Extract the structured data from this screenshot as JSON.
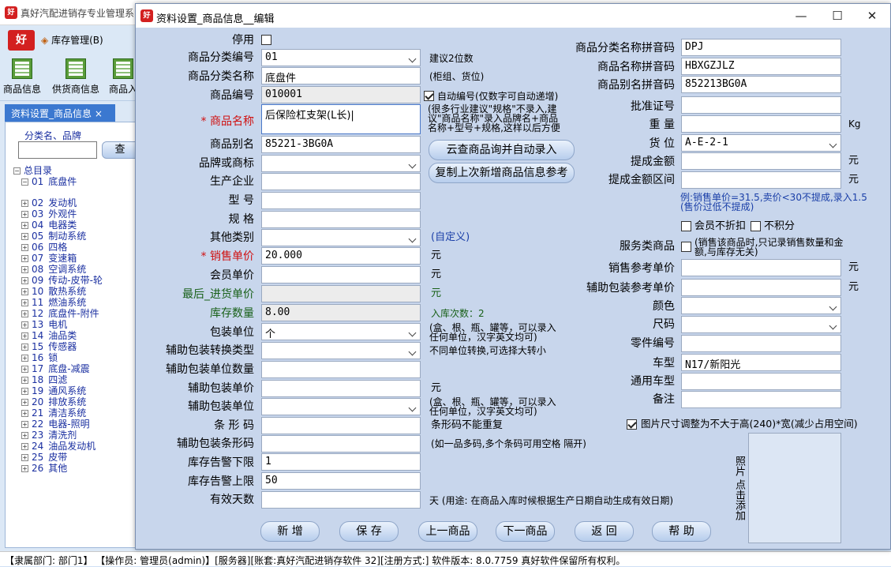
{
  "app": {
    "title": "真好汽配进销存专业管理系",
    "icon_text": "好",
    "menu_inventory": "库存管理(B)"
  },
  "toolbar": [
    {
      "label": "商品信息"
    },
    {
      "label": "供货商信息"
    },
    {
      "label": "商品入"
    }
  ],
  "left_panel": {
    "tab": "资料设置_商品信息",
    "tab_close": "×",
    "search_label": "分类名、品牌",
    "search_value": "",
    "search_button": "查"
  },
  "tree": {
    "root": "总目录",
    "items": [
      {
        "code": "01",
        "name": "底盘件",
        "expanded": true
      },
      {
        "code": "02",
        "name": "发动机"
      },
      {
        "code": "03",
        "name": "外观件"
      },
      {
        "code": "04",
        "name": "电器类"
      },
      {
        "code": "05",
        "name": "制动系统"
      },
      {
        "code": "06",
        "name": "四格"
      },
      {
        "code": "07",
        "name": "变速箱"
      },
      {
        "code": "08",
        "name": "空调系统"
      },
      {
        "code": "09",
        "name": "传动-皮带-轮"
      },
      {
        "code": "10",
        "name": "散热系统"
      },
      {
        "code": "11",
        "name": "燃油系统"
      },
      {
        "code": "12",
        "name": "底盘件-附件"
      },
      {
        "code": "13",
        "name": "电机"
      },
      {
        "code": "14",
        "name": "油品类"
      },
      {
        "code": "15",
        "name": "传感器"
      },
      {
        "code": "16",
        "name": "锁"
      },
      {
        "code": "17",
        "name": "底盘-减震"
      },
      {
        "code": "18",
        "name": "四滤"
      },
      {
        "code": "19",
        "name": "通风系统"
      },
      {
        "code": "20",
        "name": "排放系统"
      },
      {
        "code": "21",
        "name": "清洁系统"
      },
      {
        "code": "22",
        "name": "电器-照明"
      },
      {
        "code": "23",
        "name": "清洗剂"
      },
      {
        "code": "24",
        "name": "油品发动机"
      },
      {
        "code": "25",
        "name": "皮带"
      },
      {
        "code": "26",
        "name": "其他"
      }
    ]
  },
  "dialog": {
    "title": "资料设置_商品信息__编辑",
    "window_buttons": {
      "min": "—",
      "max": "☐",
      "close": "✕"
    },
    "left": {
      "disabled_label": "停用",
      "category_code": {
        "label": "商品分类编号",
        "value": "01",
        "hint": "建议2位数"
      },
      "category_name": {
        "label": "商品分类名称",
        "value": "底盘件",
        "hint": "(柜组、货位)"
      },
      "product_code": {
        "label": "商品编号",
        "value": "010001"
      },
      "auto_code_label": "自动编号(仅数字可自动递增)",
      "name": {
        "star": "*",
        "label": "商品名称",
        "value": "后保险杠支架(L长)|",
        "hint_lines": [
          "(很多行业建议\"规格\"不录入,建",
          "议\"商品名称\"录入品牌名+商品",
          "名称+型号+规格,这样以后方便"
        ]
      },
      "alias": {
        "label": "商品别名",
        "value": "85221-3BG0A"
      },
      "brand": {
        "label": "品牌或商标",
        "value": ""
      },
      "manufacturer": {
        "label": "生产企业",
        "value": ""
      },
      "model": {
        "label": "型    号",
        "value": ""
      },
      "spec": {
        "label": "规    格",
        "value": ""
      },
      "other_category": {
        "label": "其他类别",
        "value": "",
        "hint": "(自定义)"
      },
      "sale_price": {
        "star": "*",
        "label": "销售单价",
        "value": "20.000",
        "unit": "元"
      },
      "member_price": {
        "label": "会员单价",
        "value": "",
        "unit": "元"
      },
      "last_purchase": {
        "label": "最后_进货单价",
        "value": "",
        "unit": "元"
      },
      "stock_qty": {
        "label": "库存数量",
        "value": "8.00",
        "hint": "入库次数：2"
      },
      "pack_unit": {
        "label": "包装单位",
        "value": "个",
        "hint_lines": [
          "(盒、根、瓶、罐等，可以录入",
          "任何单位，汉字英文均可)"
        ]
      },
      "aux_convert_type": {
        "label": "辅助包装转换类型",
        "value": "",
        "hint": "不同单位转换,可选择大转小"
      },
      "aux_qty": {
        "label": "辅助包装单位数量",
        "value": ""
      },
      "aux_price": {
        "label": "辅助包装单价",
        "value": "",
        "unit": "元"
      },
      "aux_unit": {
        "label": "辅助包装单位",
        "value": "",
        "hint_lines": [
          "(盒、根、瓶、罐等，可以录入",
          "任何单位，汉字英文均可)"
        ]
      },
      "barcode": {
        "label": "条 形 码",
        "value": "",
        "hint": "条形码不能重复"
      },
      "aux_barcode": {
        "label": "辅助包装条形码",
        "value": "",
        "hint": "(如一品多码,多个条码可用空格 隔开)"
      },
      "stock_low": {
        "label": "库存告警下限",
        "value": "1"
      },
      "stock_high": {
        "label": "库存告警上限",
        "value": "50"
      },
      "valid_days": {
        "label": "有效天数",
        "value": "",
        "hint": "天 (用途: 在商品入库时候根据生产日期自动生成有效日期)"
      }
    },
    "middle_buttons": {
      "cloud_lookup": "云查商品询并自动录入",
      "copy_last": "复制上次新增商品信息参考"
    },
    "right": {
      "category_pinyin": {
        "label": "商品分类名称拼音码",
        "value": "DPJ"
      },
      "name_pinyin": {
        "label": "商品名称拼音码",
        "value": "HBXGZJLZ"
      },
      "alias_pinyin": {
        "label": "商品别名拼音码",
        "value": "852213BG0A"
      },
      "approval_no": {
        "label": "批准证号",
        "value": ""
      },
      "weight": {
        "label": "重    量",
        "value": "",
        "unit": "Kg"
      },
      "location": {
        "label": "货    位",
        "value": "A-E-2-1"
      },
      "commission": {
        "label": "提成金额",
        "value": "",
        "unit": "元"
      },
      "commission_range": {
        "label": "提成金额区间",
        "value": "",
        "unit": "元"
      },
      "commission_hint_lines": [
        "例:销售单价=31.5,卖价<30不提成,录入1.5",
        "(售价过低不提成)"
      ],
      "no_discount_label": "会员不折扣",
      "no_points_label": "不积分",
      "service_label": "服务类商品",
      "service_hint_lines": [
        "(销售该商品时,只记录销售数量和金",
        "额,与库存无关)"
      ],
      "ref_price": {
        "label": "销售参考单价",
        "value": "",
        "unit": "元"
      },
      "aux_ref_price": {
        "label": "辅助包装参考单价",
        "value": "",
        "unit": "元"
      },
      "color": {
        "label": "颜色",
        "value": ""
      },
      "size": {
        "label": "尺码",
        "value": ""
      },
      "part_no": {
        "label": "零件编号",
        "value": ""
      },
      "vehicle": {
        "label": "车型",
        "value": "N17/新阳光"
      },
      "common_vehicle": {
        "label": "通用车型",
        "value": ""
      },
      "remark": {
        "label": "备注",
        "value": ""
      },
      "image_resize_label": "图片尺寸调整为不大于高(240)*宽(减少占用空间)",
      "photo_hint": "照片  点击添加"
    },
    "buttons": {
      "new": "新  增",
      "save": "保  存",
      "prev": "上一商品",
      "next": "下一商品",
      "back": "返  回",
      "help": "帮  助"
    }
  },
  "statusbar": "【隶属部门: 部门1】 【操作员: 管理员(admin)】[服务器][账套:真好汽配进销存软件 32][注册方式:] 软件版本: 8.0.7759 真好软件保留所有权利。"
}
